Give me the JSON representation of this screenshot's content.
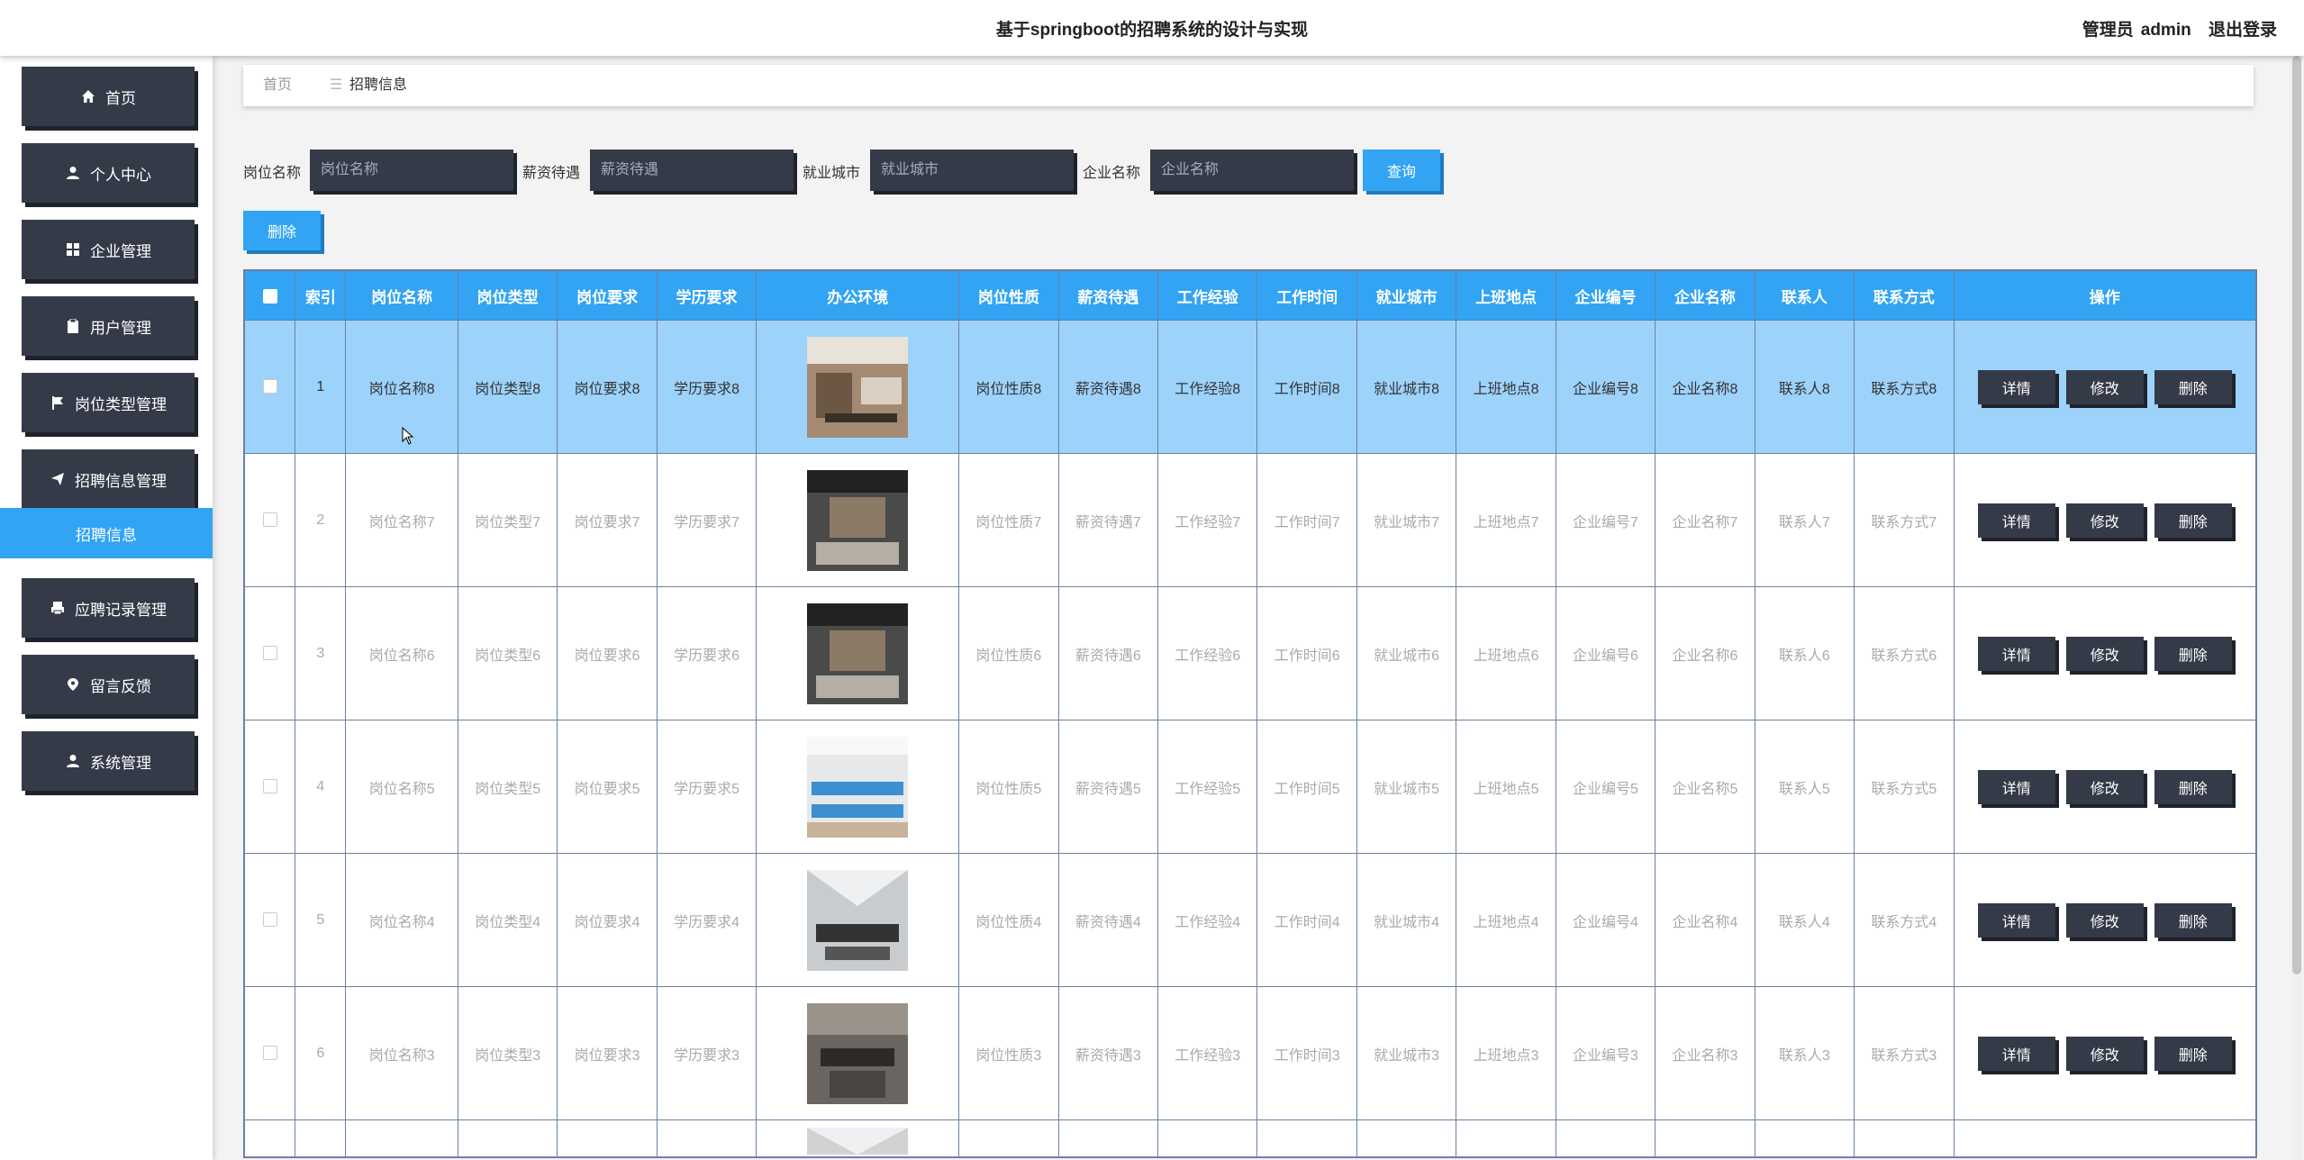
{
  "header": {
    "title": "基于springboot的招聘系统的设计与实现",
    "role": "管理员",
    "username": "admin",
    "logout": "退出登录"
  },
  "sidebar": {
    "items": [
      {
        "label": "首页",
        "icon": "home-icon"
      },
      {
        "label": "个人中心",
        "icon": "user-icon"
      },
      {
        "label": "企业管理",
        "icon": "grid-icon"
      },
      {
        "label": "用户管理",
        "icon": "clipboard-icon"
      },
      {
        "label": "岗位类型管理",
        "icon": "flag-icon"
      },
      {
        "label": "招聘信息管理",
        "icon": "paper-plane-icon"
      },
      {
        "label": "应聘记录管理",
        "icon": "printer-icon"
      },
      {
        "label": "留言反馈",
        "icon": "location-pin-icon"
      },
      {
        "label": "系统管理",
        "icon": "user-icon"
      }
    ],
    "sub_item": "招聘信息"
  },
  "breadcrumb": {
    "home": "首页",
    "separator": "☰",
    "current": "招聘信息"
  },
  "search": {
    "fields": [
      {
        "label": "岗位名称",
        "placeholder": "岗位名称"
      },
      {
        "label": "薪资待遇",
        "placeholder": "薪资待遇"
      },
      {
        "label": "就业城市",
        "placeholder": "就业城市"
      },
      {
        "label": "企业名称",
        "placeholder": "企业名称"
      }
    ],
    "query_button": "查询",
    "delete_button": "删除"
  },
  "table": {
    "columns": [
      "索引",
      "岗位名称",
      "岗位类型",
      "岗位要求",
      "学历要求",
      "办公环境",
      "岗位性质",
      "薪资待遇",
      "工作经验",
      "工作时间",
      "就业城市",
      "上班地点",
      "企业编号",
      "企业名称",
      "联系人",
      "联系方式",
      "操作"
    ],
    "actions": {
      "detail": "详情",
      "edit": "修改",
      "delete": "删除"
    },
    "rows": [
      {
        "index": "1",
        "name": "岗位名称8",
        "type": "岗位类型8",
        "req": "岗位要求8",
        "edu": "学历要求8",
        "nature": "岗位性质8",
        "salary": "薪资待遇8",
        "exp": "工作经验8",
        "time": "工作时间8",
        "city": "就业城市8",
        "place": "上班地点8",
        "code": "企业编号8",
        "company": "企业名称8",
        "contact": "联系人8",
        "phone": "联系方式8",
        "selected": true
      },
      {
        "index": "2",
        "name": "岗位名称7",
        "type": "岗位类型7",
        "req": "岗位要求7",
        "edu": "学历要求7",
        "nature": "岗位性质7",
        "salary": "薪资待遇7",
        "exp": "工作经验7",
        "time": "工作时间7",
        "city": "就业城市7",
        "place": "上班地点7",
        "code": "企业编号7",
        "company": "企业名称7",
        "contact": "联系人7",
        "phone": "联系方式7",
        "selected": false
      },
      {
        "index": "3",
        "name": "岗位名称6",
        "type": "岗位类型6",
        "req": "岗位要求6",
        "edu": "学历要求6",
        "nature": "岗位性质6",
        "salary": "薪资待遇6",
        "exp": "工作经验6",
        "time": "工作时间6",
        "city": "就业城市6",
        "place": "上班地点6",
        "code": "企业编号6",
        "company": "企业名称6",
        "contact": "联系人6",
        "phone": "联系方式6",
        "selected": false
      },
      {
        "index": "4",
        "name": "岗位名称5",
        "type": "岗位类型5",
        "req": "岗位要求5",
        "edu": "学历要求5",
        "nature": "岗位性质5",
        "salary": "薪资待遇5",
        "exp": "工作经验5",
        "time": "工作时间5",
        "city": "就业城市5",
        "place": "上班地点5",
        "code": "企业编号5",
        "company": "企业名称5",
        "contact": "联系人5",
        "phone": "联系方式5",
        "selected": false
      },
      {
        "index": "5",
        "name": "岗位名称4",
        "type": "岗位类型4",
        "req": "岗位要求4",
        "edu": "学历要求4",
        "nature": "岗位性质4",
        "salary": "薪资待遇4",
        "exp": "工作经验4",
        "time": "工作时间4",
        "city": "就业城市4",
        "place": "上班地点4",
        "code": "企业编号4",
        "company": "企业名称4",
        "contact": "联系人4",
        "phone": "联系方式4",
        "selected": false
      },
      {
        "index": "6",
        "name": "岗位名称3",
        "type": "岗位类型3",
        "req": "岗位要求3",
        "edu": "学历要求3",
        "nature": "岗位性质3",
        "salary": "薪资待遇3",
        "exp": "工作经验3",
        "time": "工作时间3",
        "city": "就业城市3",
        "place": "上班地点3",
        "code": "企业编号3",
        "company": "企业名称3",
        "contact": "联系人3",
        "phone": "联系方式3",
        "selected": false
      },
      {
        "index": "",
        "name": "",
        "type": "",
        "req": "",
        "edu": "",
        "nature": "",
        "salary": "",
        "exp": "",
        "time": "",
        "city": "",
        "place": "",
        "code": "",
        "company": "",
        "contact": "",
        "phone": "",
        "selected": false,
        "partial": true
      }
    ]
  },
  "colors": {
    "accent": "#32a4f3",
    "dark_button": "#343a48",
    "selected_row": "#9dd2fb"
  }
}
